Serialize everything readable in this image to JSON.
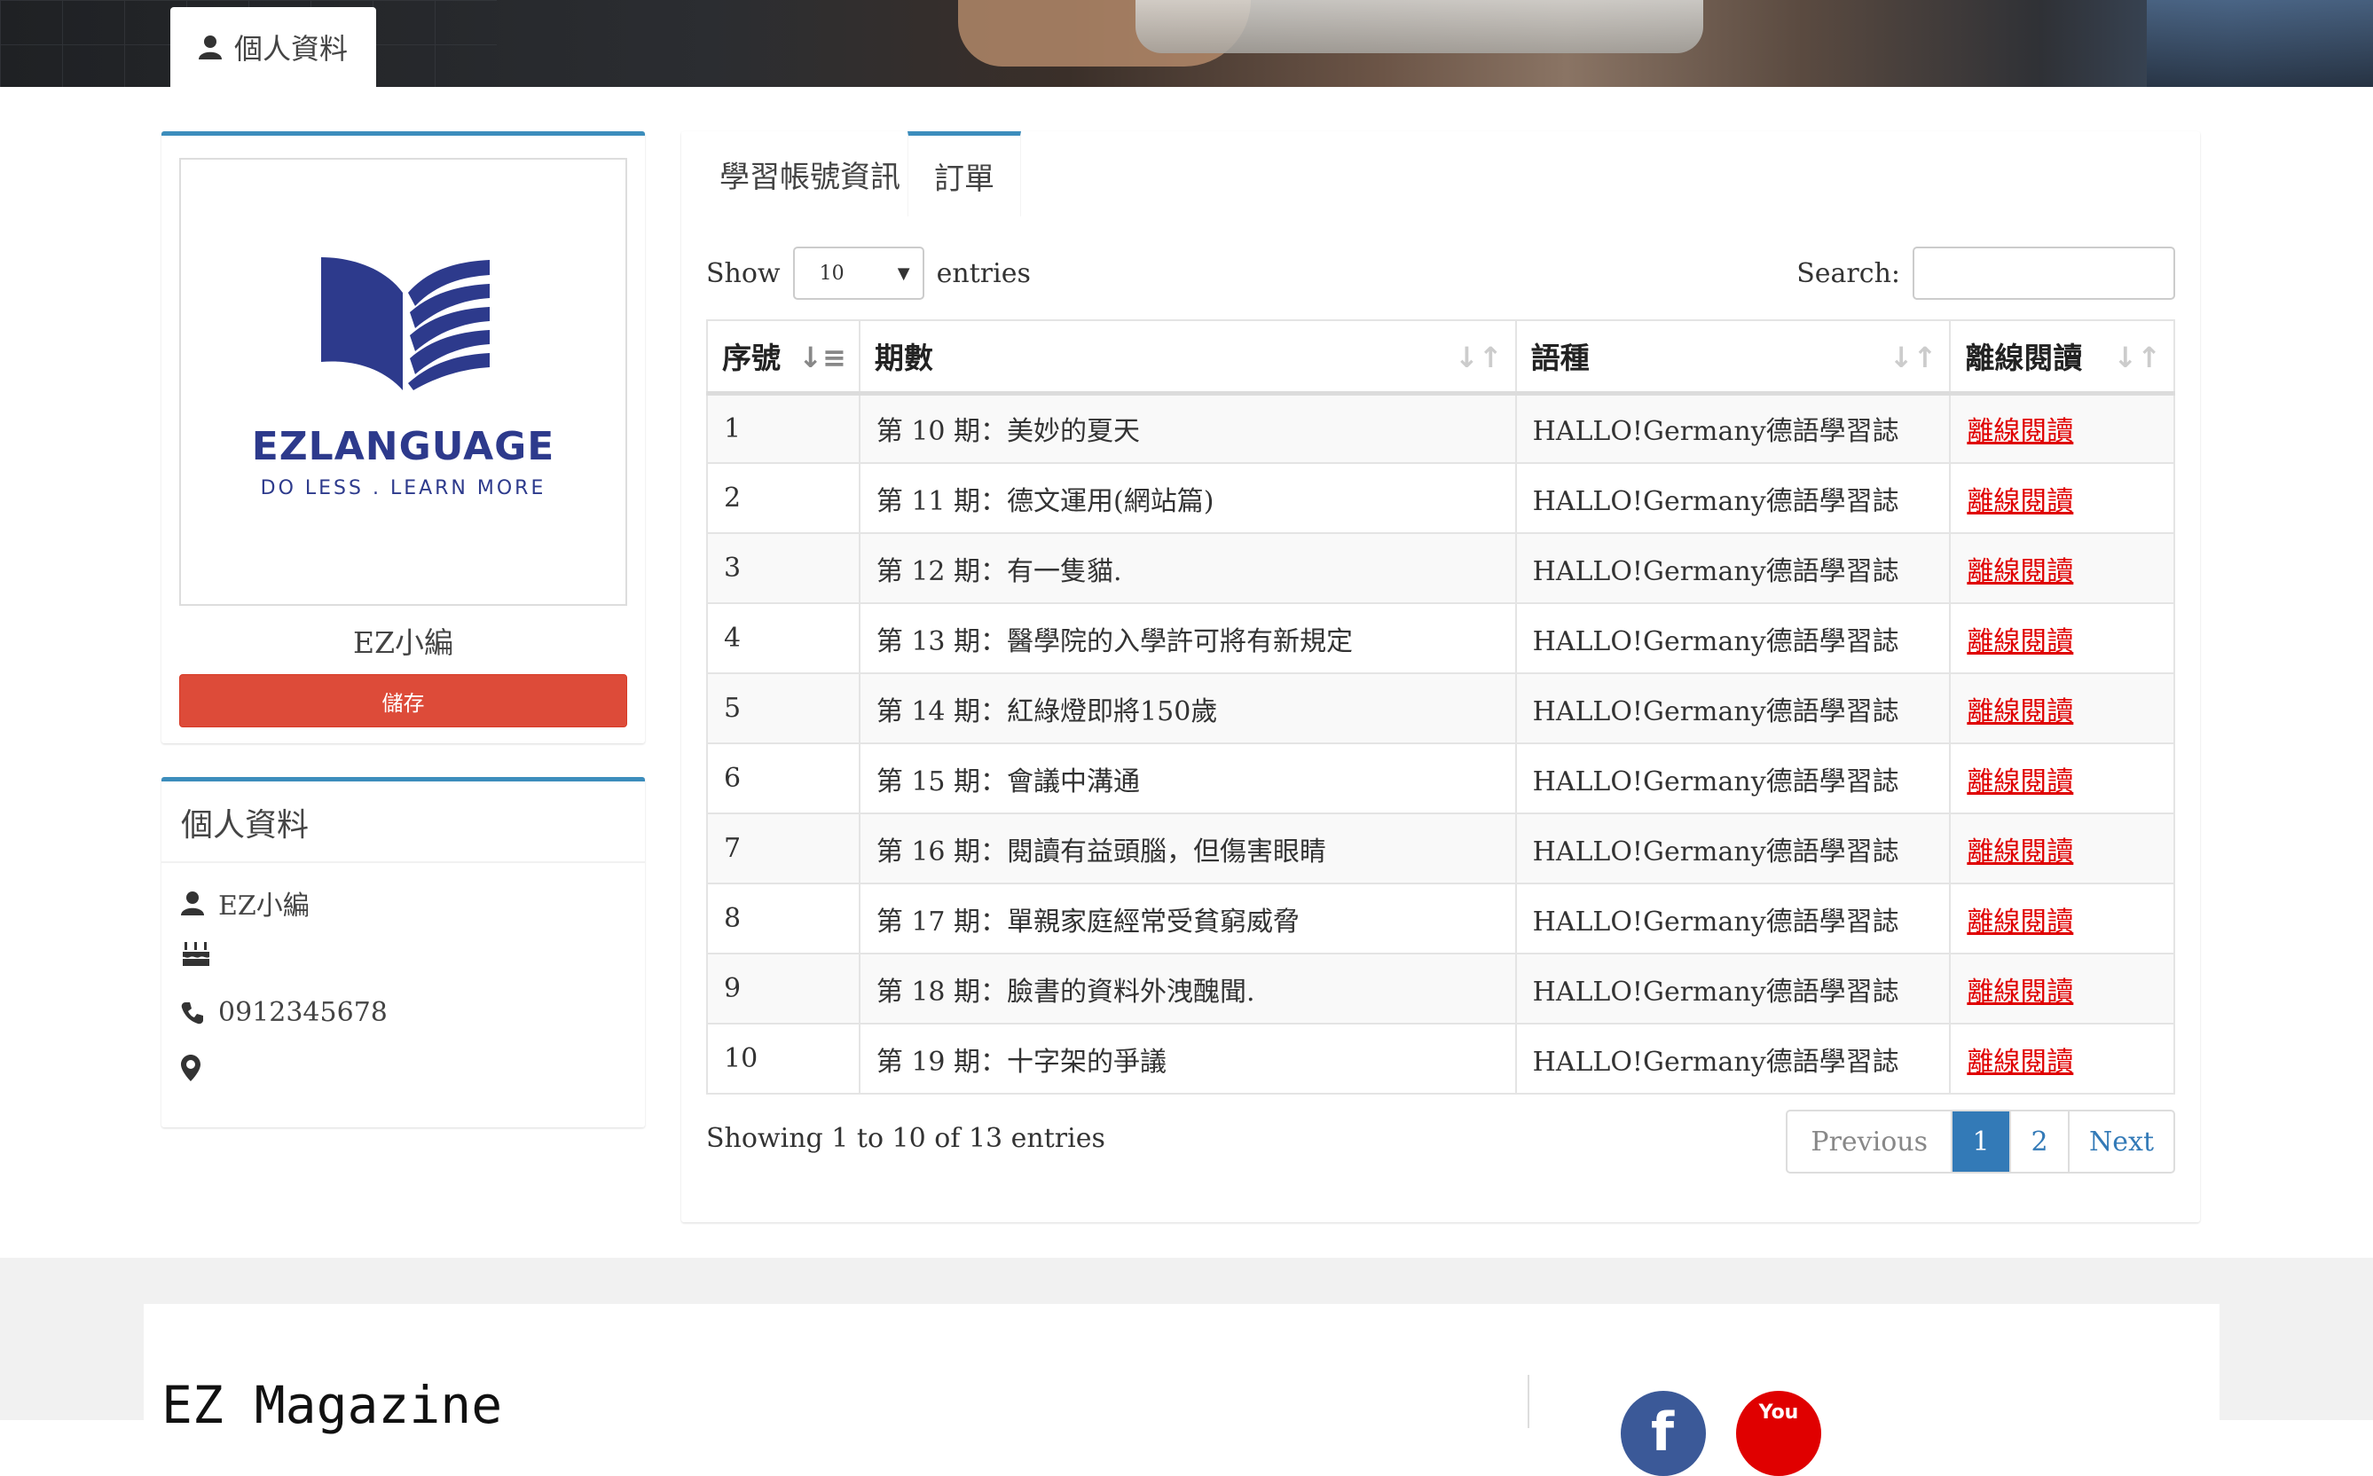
{
  "header": {
    "profile_tab_label": "個人資料"
  },
  "profile": {
    "logo_title": "EZLANGUAGE",
    "logo_tagline": "DO LESS . LEARN MORE",
    "name": "EZ小編",
    "save_label": "儲存"
  },
  "personal_info": {
    "title": "個人資料",
    "name": "EZ小編",
    "phone": "0912345678"
  },
  "tabs": [
    {
      "label": "學習帳號資訊"
    },
    {
      "label": "訂單"
    }
  ],
  "table_controls": {
    "show_label": "Show",
    "page_size": "10",
    "entries_label": "entries",
    "search_label": "Search:"
  },
  "table": {
    "headers": [
      "序號",
      "期數",
      "語種",
      "離線閱讀"
    ],
    "rows": [
      [
        "1",
        "第 10 期：美妙的夏天",
        "HALLO!Germany德語學習誌",
        "離線閱讀"
      ],
      [
        "2",
        "第 11 期：德文運用(網站篇)",
        "HALLO!Germany德語學習誌",
        "離線閱讀"
      ],
      [
        "3",
        "第 12 期：有一隻貓.",
        "HALLO!Germany德語學習誌",
        "離線閱讀"
      ],
      [
        "4",
        "第 13 期：醫學院的入學許可將有新規定",
        "HALLO!Germany德語學習誌",
        "離線閱讀"
      ],
      [
        "5",
        "第 14 期：紅綠燈即將150歲",
        "HALLO!Germany德語學習誌",
        "離線閱讀"
      ],
      [
        "6",
        "第 15 期：會議中溝通",
        "HALLO!Germany德語學習誌",
        "離線閱讀"
      ],
      [
        "7",
        "第 16 期：閱讀有益頭腦，但傷害眼睛",
        "HALLO!Germany德語學習誌",
        "離線閱讀"
      ],
      [
        "8",
        "第 17 期：單親家庭經常受貧窮威脅",
        "HALLO!Germany德語學習誌",
        "離線閱讀"
      ],
      [
        "9",
        "第 18 期：臉書的資料外洩醜聞.",
        "HALLO!Germany德語學習誌",
        "離線閱讀"
      ],
      [
        "10",
        "第 19 期：十字架的爭議",
        "HALLO!Germany德語學習誌",
        "離線閱讀"
      ]
    ]
  },
  "pagination": {
    "summary": "Showing 1 to 10 of 13 entries",
    "previous": "Previous",
    "pages": [
      "1",
      "2"
    ],
    "next": "Next"
  },
  "footer": {
    "title": "EZ Magazine",
    "youtube_label": "You"
  },
  "colors": {
    "accent": "#3c8dbc",
    "save_button": "#dd4b39",
    "link": "#e00000",
    "brand": "#2d3a8c"
  }
}
